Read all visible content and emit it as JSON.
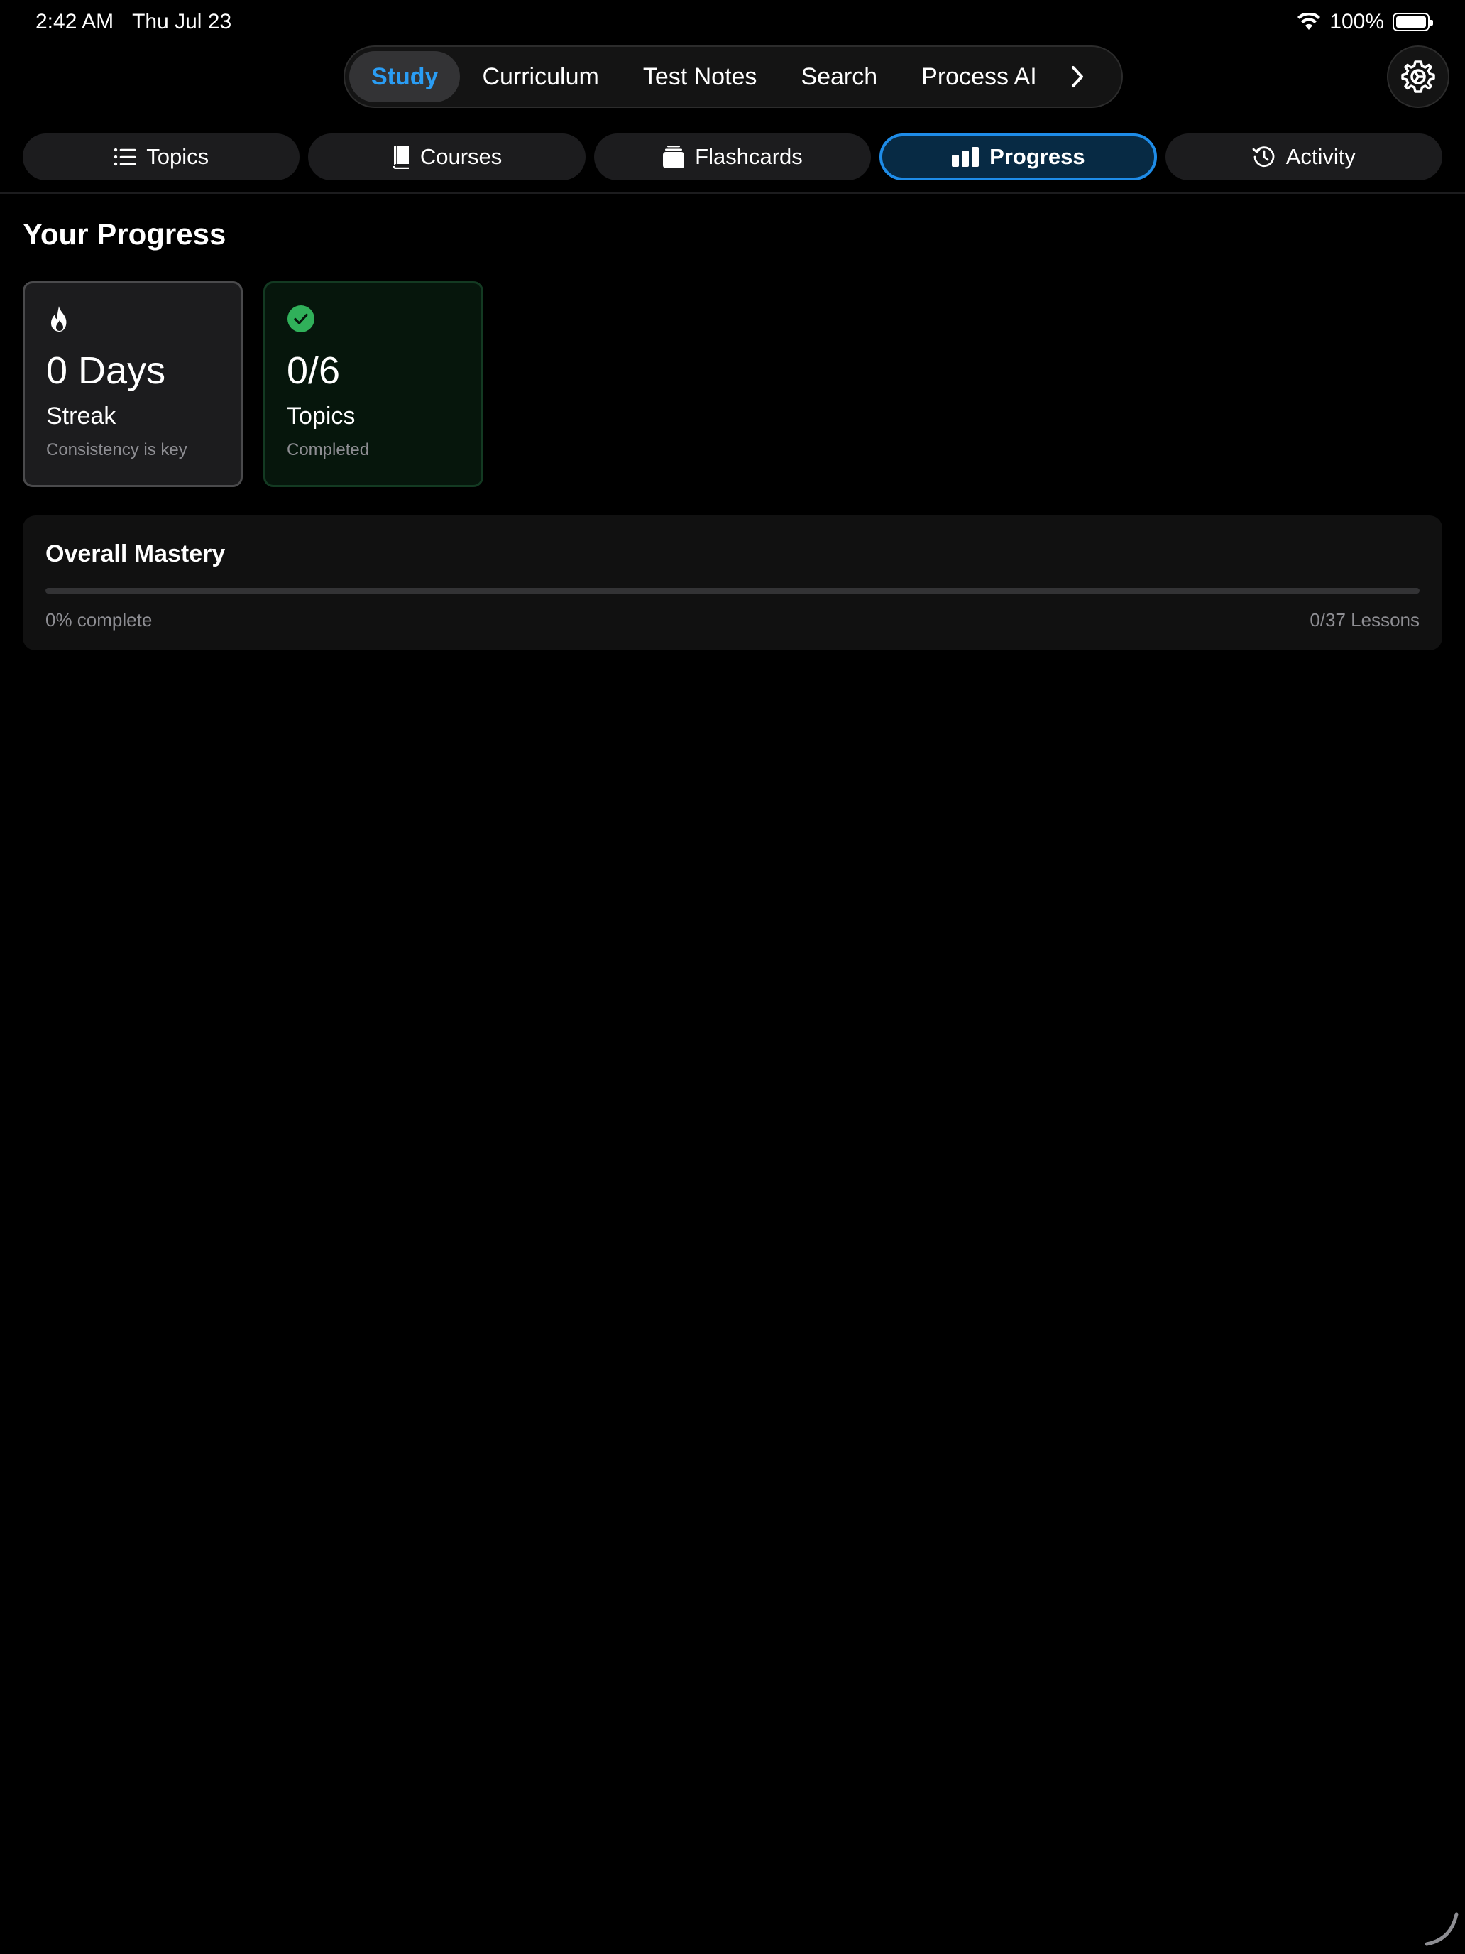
{
  "status_bar": {
    "time": "2:42 AM",
    "date": "Thu Jul 23",
    "battery": "100%"
  },
  "top_nav": {
    "items": [
      {
        "label": "Study",
        "active": true
      },
      {
        "label": "Curriculum",
        "active": false
      },
      {
        "label": "Test Notes",
        "active": false
      },
      {
        "label": "Search",
        "active": false
      },
      {
        "label": "Process AI",
        "active": false
      }
    ],
    "more_icon": "chevron-right-icon",
    "settings_icon": "gear-icon"
  },
  "sub_tabs": {
    "items": [
      {
        "label": "Topics",
        "icon": "list-icon",
        "active": false
      },
      {
        "label": "Courses",
        "icon": "book-icon",
        "active": false
      },
      {
        "label": "Flashcards",
        "icon": "cards-stack-icon",
        "active": false
      },
      {
        "label": "Progress",
        "icon": "bar-chart-icon",
        "active": true
      },
      {
        "label": "Activity",
        "icon": "history-icon",
        "active": false
      }
    ]
  },
  "main": {
    "title": "Your Progress",
    "streak_card": {
      "icon": "flame-icon",
      "value": "0 Days",
      "label": "Streak",
      "subtitle": "Consistency is key"
    },
    "topics_card": {
      "icon": "checkmark-circle-icon",
      "value": "0/6",
      "label": "Topics",
      "subtitle": "Completed"
    },
    "mastery": {
      "title": "Overall Mastery",
      "progress_percent": 0,
      "complete_text": "0% complete",
      "lessons_text": "0/37 Lessons"
    }
  },
  "colors": {
    "accent": "#2a9df4",
    "active_tab_bg": "#072a44",
    "success": "#30b05a",
    "background": "#000000"
  }
}
